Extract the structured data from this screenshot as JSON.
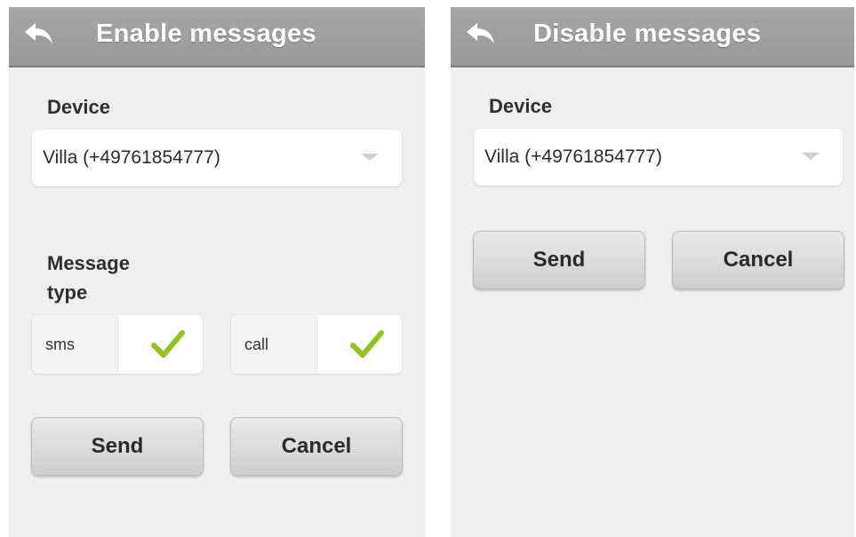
{
  "screens": {
    "enable": {
      "title": "Enable messages",
      "device_label": "Device",
      "device_value": "Villa (+49761854777)",
      "message_type_label_line1": "Message",
      "message_type_label_line2": "type",
      "options": [
        {
          "label": "sms",
          "checked": true
        },
        {
          "label": "call",
          "checked": true
        }
      ],
      "send_label": "Send",
      "cancel_label": "Cancel"
    },
    "disable": {
      "title": "Disable messages",
      "device_label": "Device",
      "device_value": "Villa (+49761854777)",
      "send_label": "Send",
      "cancel_label": "Cancel"
    }
  },
  "icons": {
    "back": "back-arrow-icon",
    "dropdown": "chevron-down-icon",
    "check": "checkmark-icon"
  },
  "colors": {
    "titlebar": "#a0a0a0",
    "background": "#efefef",
    "check": "#8fc31f"
  }
}
